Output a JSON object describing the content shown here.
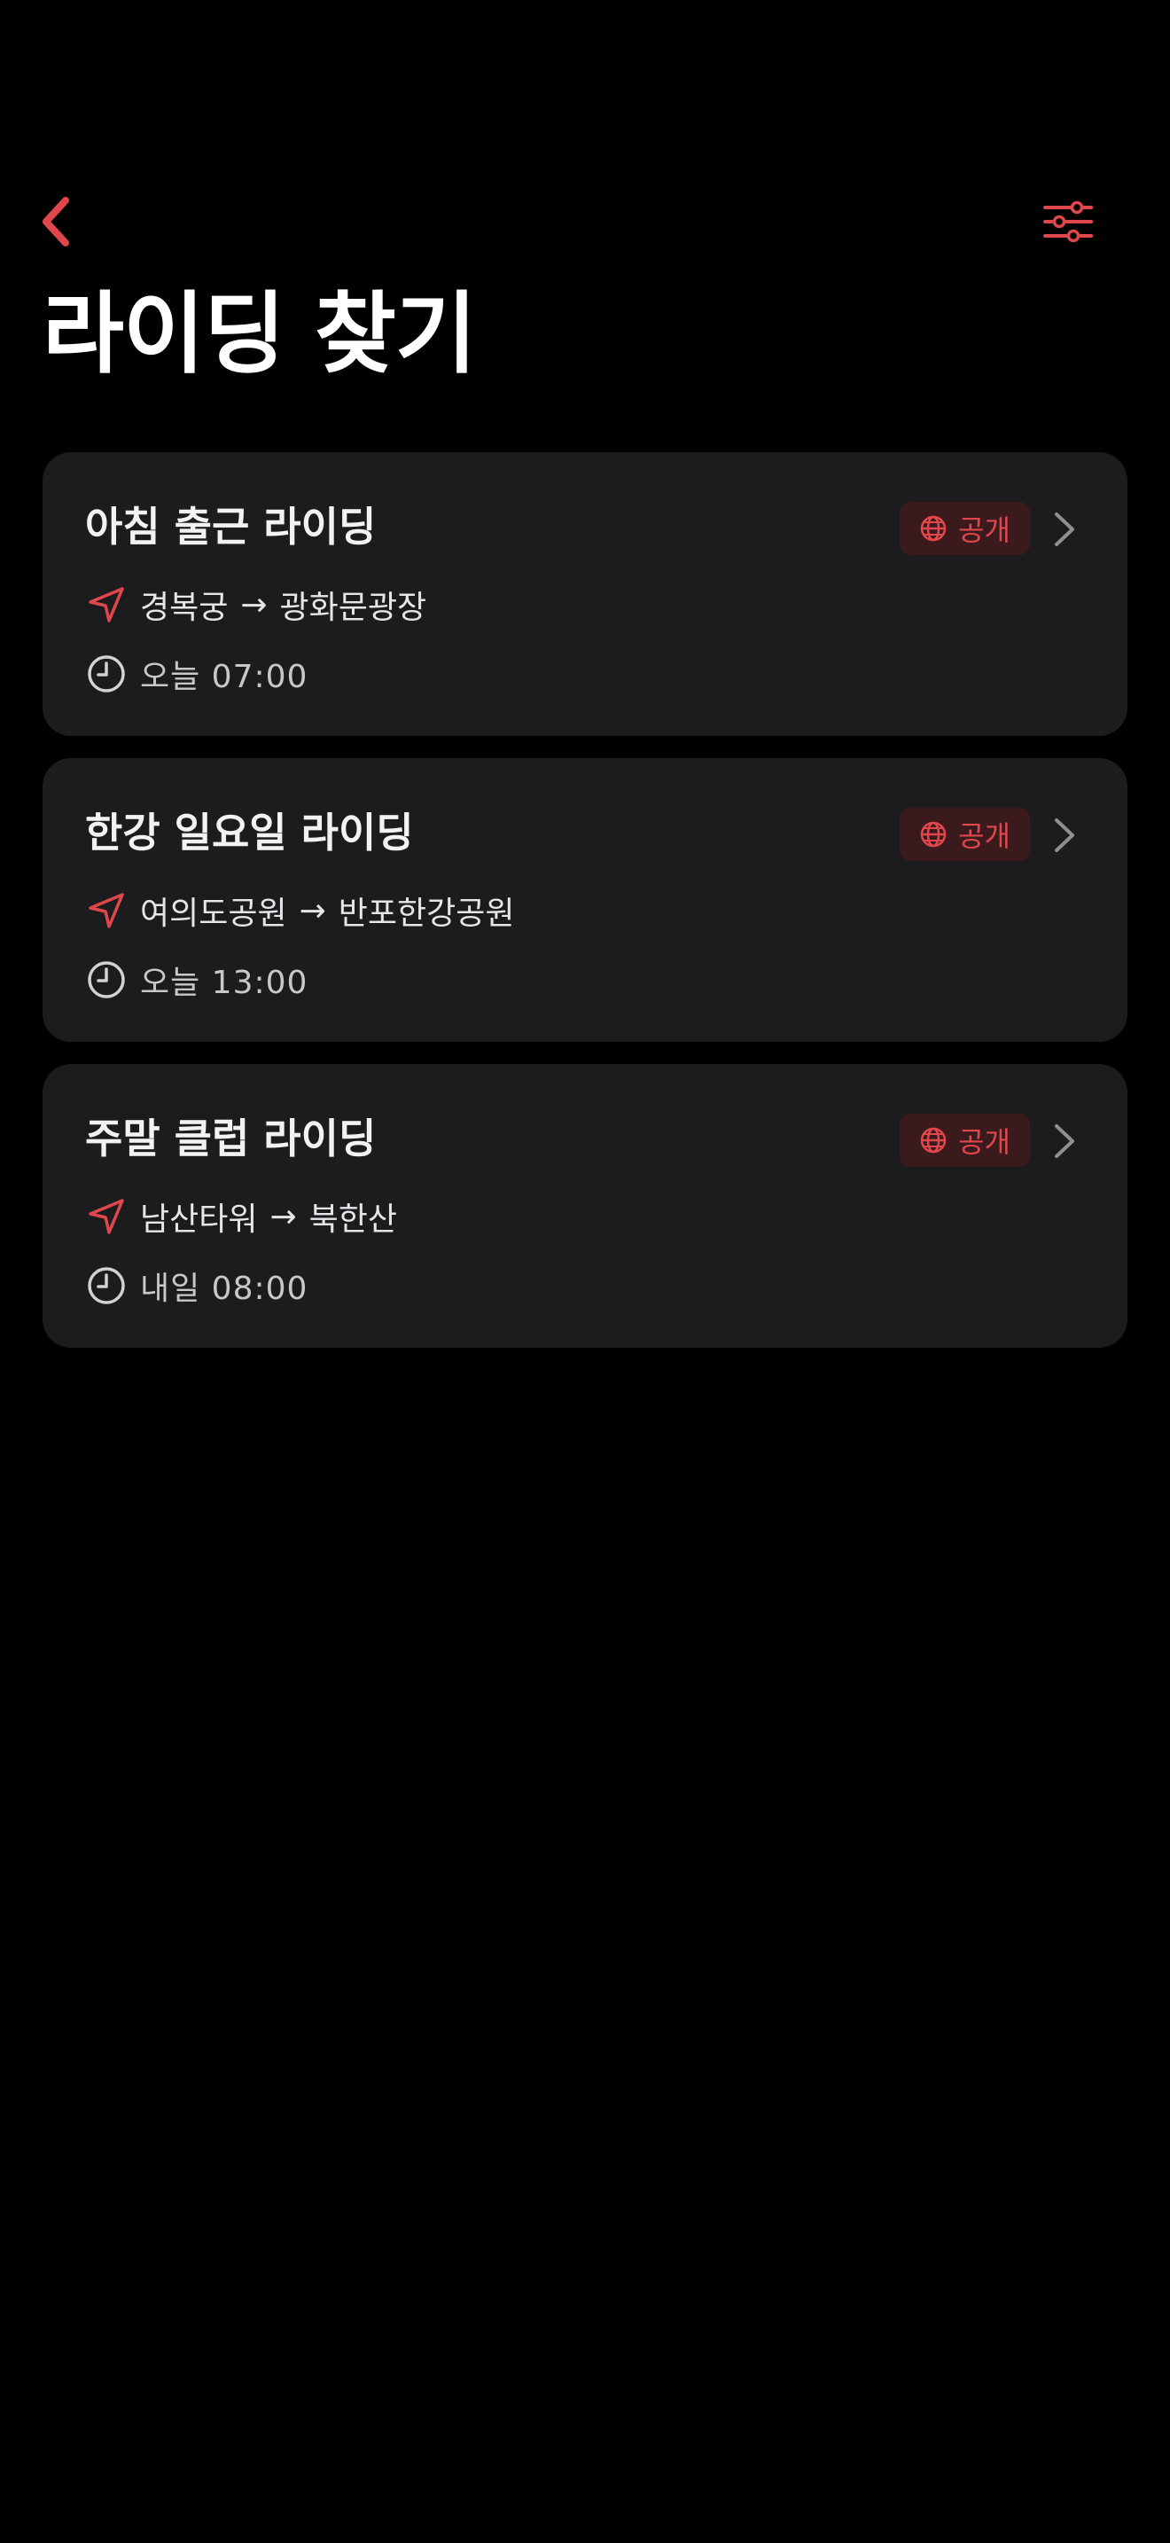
{
  "header": {
    "title": "라이딩 찾기",
    "back_icon": "chevron-left-icon",
    "filter_icon": "sliders-icon"
  },
  "colors": {
    "accent": "#e0474c",
    "background": "#000000",
    "card": "#1c1c1e",
    "badge_bg": "#3a1a1c"
  },
  "rides": [
    {
      "title": "아침 출근 라이딩",
      "visibility": "공개",
      "from": "경복궁",
      "arrow": "→",
      "to": "광화문광장",
      "time": "오늘 07:00"
    },
    {
      "title": "한강 일요일 라이딩",
      "visibility": "공개",
      "from": "여의도공원",
      "arrow": "→",
      "to": "반포한강공원",
      "time": "오늘 13:00"
    },
    {
      "title": "주말 클럽 라이딩",
      "visibility": "공개",
      "from": "남산타워",
      "arrow": "→",
      "to": "북한산",
      "time": "내일 08:00"
    }
  ]
}
